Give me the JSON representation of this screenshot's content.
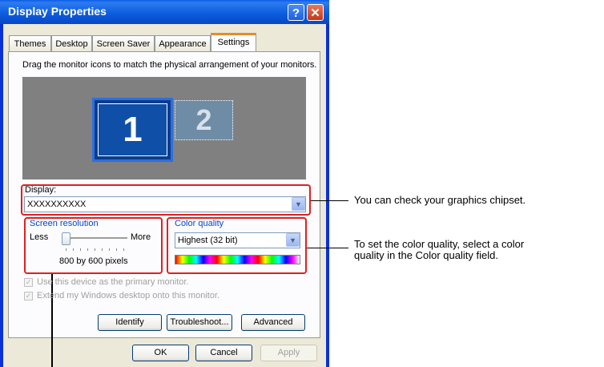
{
  "window": {
    "title": "Display Properties",
    "help_glyph": "?",
    "close_glyph": "✕"
  },
  "tabs": [
    {
      "label": "Themes"
    },
    {
      "label": "Desktop"
    },
    {
      "label": "Screen Saver"
    },
    {
      "label": "Appearance"
    },
    {
      "label": "Settings",
      "active": true
    }
  ],
  "settings": {
    "instruction": "Drag the monitor icons to match the physical arrangement of your monitors.",
    "monitors": [
      {
        "number": "1",
        "selected": true
      },
      {
        "number": "2",
        "selected": false
      }
    ],
    "display_label": "Display:",
    "display_value": "XXXXXXXXXX",
    "screen_resolution": {
      "label": "Screen resolution",
      "less": "Less",
      "more": "More",
      "value_text": "800 by 600 pixels",
      "slider_fraction": 0.0
    },
    "color_quality": {
      "label": "Color quality",
      "value": "Highest (32 bit)"
    },
    "checkbox_primary": {
      "label": "Use this device as the primary monitor.",
      "checked": true,
      "disabled": true
    },
    "checkbox_extend": {
      "label": "Extend my Windows desktop onto this monitor.",
      "checked": true,
      "disabled": true
    },
    "buttons": {
      "identify": "Identify",
      "troubleshoot": "Troubleshoot...",
      "advanced": "Advanced"
    }
  },
  "dialog_buttons": {
    "ok": "OK",
    "cancel": "Cancel",
    "apply": "Apply"
  },
  "annotations": {
    "display_note": "You can check your graphics chipset.",
    "color_note_line1": "To set the color quality, select a color",
    "color_note_line2": "quality in the Color quality field."
  },
  "colors": {
    "highlight_box": "#e02020",
    "titlebar": "#0a5ce8"
  }
}
